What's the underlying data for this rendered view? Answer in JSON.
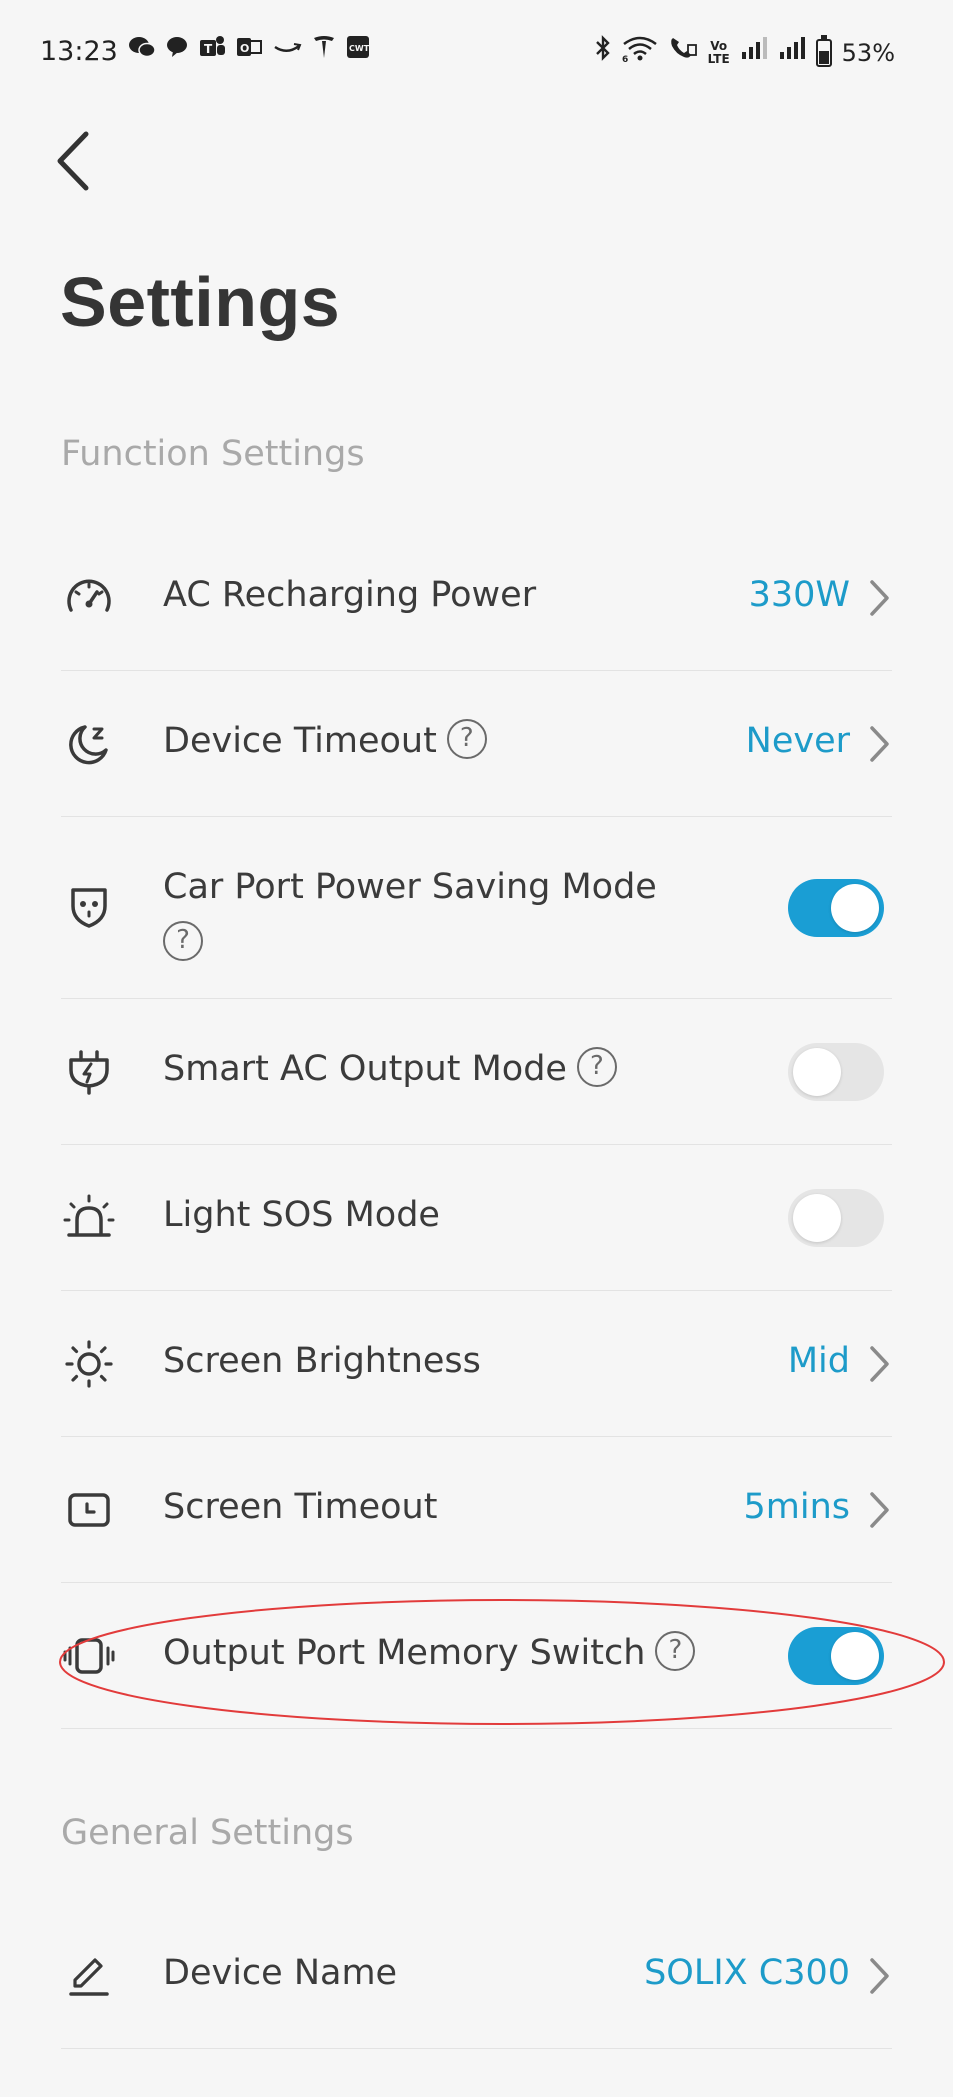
{
  "status_bar": {
    "time": "13:23",
    "battery_percent": "53%",
    "network_label": "Vo\nLTE",
    "left_icons": [
      "wechat-icon",
      "chat-bubble-icon",
      "teams-icon",
      "outlook-icon",
      "amazon-icon",
      "tesla-icon",
      "cwt-icon"
    ],
    "right_icons": [
      "bluetooth-icon",
      "wifi-icon",
      "wifi-call-icon",
      "volte-icon",
      "signal-icon",
      "signal-icon",
      "battery-icon"
    ]
  },
  "header": {
    "back_icon": "chevron-left-icon",
    "title": "Settings"
  },
  "function_settings": {
    "section_title": "Function Settings",
    "rows": [
      {
        "icon": "speedometer-icon",
        "label": "AC Recharging Power",
        "value": "330W",
        "control": "chevron"
      },
      {
        "icon": "moon-sleep-icon",
        "label": "Device Timeout",
        "help": true,
        "value": "Never",
        "control": "chevron"
      },
      {
        "icon": "car-port-icon",
        "label": "Car Port Power Saving Mode",
        "help": true,
        "control": "toggle",
        "toggle_on": true
      },
      {
        "icon": "smart-plug-icon",
        "label": "Smart AC Output Mode",
        "help": true,
        "control": "toggle",
        "toggle_on": false
      },
      {
        "icon": "siren-icon",
        "label": "Light SOS Mode",
        "control": "toggle",
        "toggle_on": false
      },
      {
        "icon": "brightness-icon",
        "label": "Screen Brightness",
        "value": "Mid",
        "control": "chevron"
      },
      {
        "icon": "screen-timeout-icon",
        "label": "Screen Timeout",
        "value": "5mins",
        "control": "chevron"
      },
      {
        "icon": "port-memory-icon",
        "label": "Output Port Memory Switch",
        "help": true,
        "control": "toggle",
        "toggle_on": true
      }
    ]
  },
  "general_settings": {
    "section_title": "General Settings",
    "rows": [
      {
        "icon": "pencil-icon",
        "label": "Device Name",
        "value": "SOLIX C300",
        "control": "chevron"
      }
    ]
  },
  "help_glyph": "?",
  "colors": {
    "accent": "#1d9bc9",
    "toggle_on": "#1a9ed4",
    "toggle_off": "#e5e5e5",
    "annotation": "#e23b3b"
  }
}
